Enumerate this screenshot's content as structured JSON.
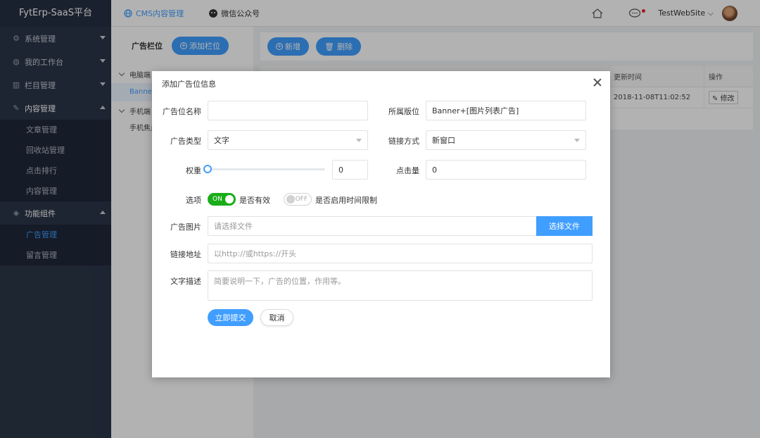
{
  "brand": "FytErp-SaaS平台",
  "sidebar": {
    "items": [
      {
        "label": "系统管理",
        "icon": "gear-icon"
      },
      {
        "label": "我的工作台",
        "icon": "globe-icon"
      },
      {
        "label": "栏目管理",
        "icon": "columns-icon"
      },
      {
        "label": "内容管理",
        "icon": "edit-icon"
      },
      {
        "label": "功能组件",
        "icon": "cube-icon"
      }
    ],
    "content_sub": [
      "文章管理",
      "回收站管理",
      "点击排行",
      "内容管理"
    ],
    "component_sub": [
      "广告管理",
      "留言管理"
    ]
  },
  "topbar": {
    "tabs": [
      "CMS内容管理",
      "微信公众号"
    ],
    "username": "TestWebSite"
  },
  "left_panel": {
    "title": "广告栏位",
    "add_button": "添加栏位",
    "nodes": [
      "电脑端",
      "手机端"
    ],
    "leaves": [
      "Banner",
      "手机焦点"
    ]
  },
  "toolbar": {
    "new": "新增",
    "delete": "删除"
  },
  "grid": {
    "headers": [
      "更新时间",
      "操作"
    ],
    "row": {
      "time": "2018-11-08T11:02:52",
      "action": "修改"
    }
  },
  "modal": {
    "title": "添加广告位信息",
    "fields": {
      "name_label": "广告位名称",
      "name_value": "",
      "position_label": "所属版位",
      "position_value": "Banner+[图片列表广告]",
      "type_label": "广告类型",
      "type_value": "文字",
      "link_mode_label": "链接方式",
      "link_mode_value": "新窗口",
      "weight_label": "权重",
      "weight_value": "0",
      "weight_level": 0,
      "clicks_label": "点击量",
      "clicks_value": "0",
      "options_label": "选项",
      "switch_on_text": "ON",
      "switch_on_label": "是否有效",
      "switch_on_state": true,
      "switch_off_text": "OFF",
      "switch_off_label": "是否启用时间限制",
      "switch_off_state": false,
      "image_label": "广告图片",
      "image_placeholder": "请选择文件",
      "image_button": "选择文件",
      "url_label": "链接地址",
      "url_placeholder": "以http://或https://开头",
      "desc_label": "文字描述",
      "desc_placeholder": "简要说明一下，广告的位置，作用等。"
    },
    "submit": "立即提交",
    "cancel": "取消"
  },
  "colors": {
    "primary": "#409eff",
    "sidebar": "#2b3648",
    "switch_on": "#1aad19"
  }
}
